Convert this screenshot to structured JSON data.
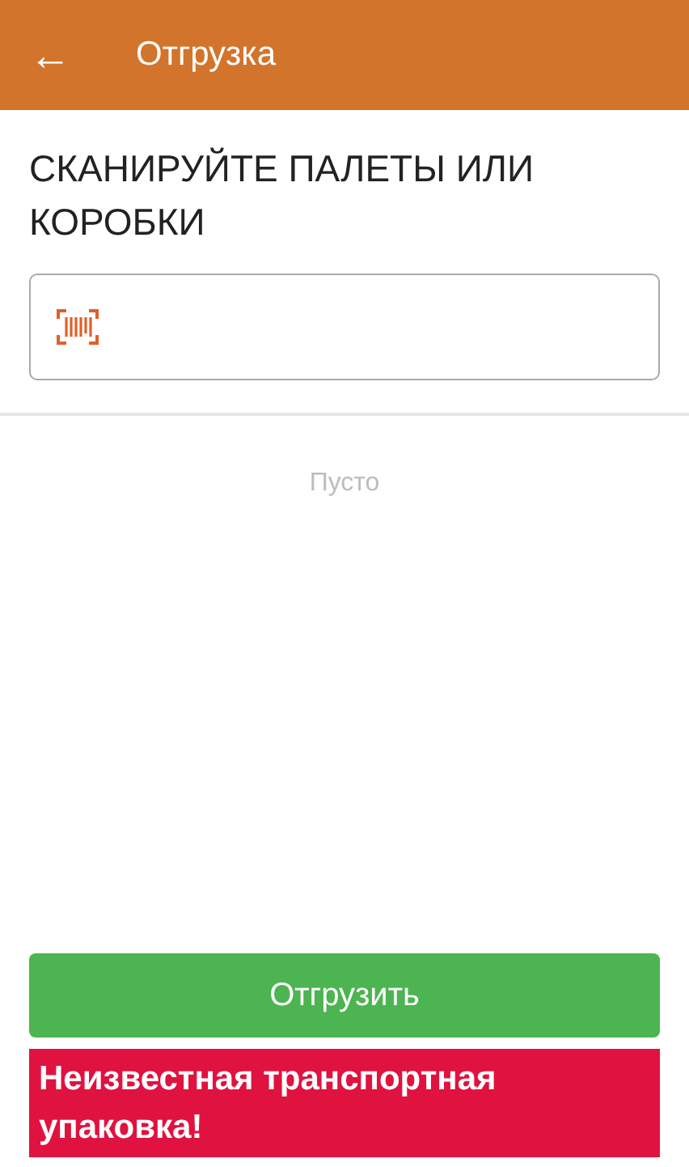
{
  "app_bar": {
    "back": "←",
    "title": "Отгрузка"
  },
  "prompt": "СКАНИРУЙТЕ ПАЛЕТЫ ИЛИ КОРОБКИ",
  "list": {
    "empty_text": "Пусто"
  },
  "button": "Отгрузить",
  "error": "Неизвестная транспортная упаковка!"
}
